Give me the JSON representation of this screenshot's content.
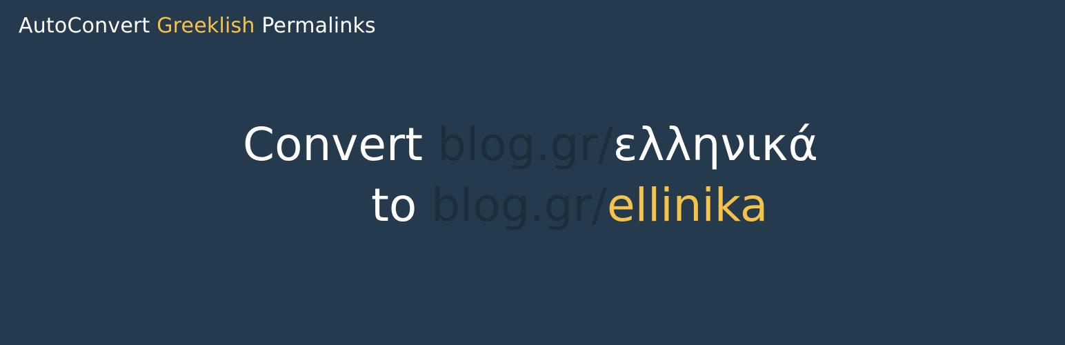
{
  "header": {
    "title_part1": "AutoConvert",
    "title_part2": "Greeklish",
    "title_part3": "Permalinks"
  },
  "hero": {
    "line1": {
      "lead": "Convert",
      "domain": "blog.gr/",
      "slug": "ελληνικά"
    },
    "line2": {
      "lead": "to",
      "domain": "blog.gr/",
      "slug": "ellinika"
    }
  },
  "colors": {
    "background": "#253b4d",
    "accent": "#f5c24c",
    "text": "#ffffff",
    "muted_domain": "#1c2d3b"
  }
}
